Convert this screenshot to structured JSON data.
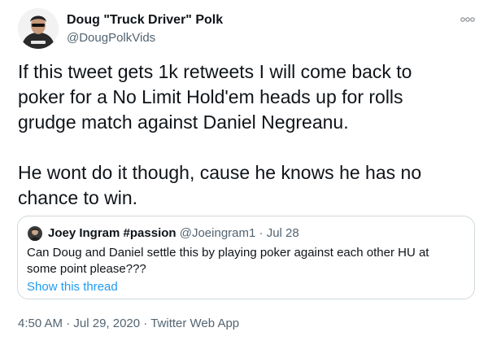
{
  "author": {
    "display_name": "Doug \"Truck Driver\" Polk",
    "handle": "@DougPolkVids"
  },
  "tweet": {
    "lines": [
      "If this tweet gets 1k retweets I will come back to",
      "poker for a No Limit Hold'em heads up for rolls",
      "grudge match against Daniel Negreanu.",
      "",
      "He wont do it though, cause he knows he has no",
      "chance to win."
    ]
  },
  "quote": {
    "display_name": "Joey Ingram #passion",
    "handle": "@Joeingram1",
    "separator": "·",
    "date": "Jul 28",
    "lines": [
      "Can Doug and Daniel settle this by playing poker against each other HU at",
      "some point please???"
    ],
    "show_thread_label": "Show this thread"
  },
  "footer": {
    "time": "4:50 AM",
    "date": "Jul 29, 2020",
    "source": "Twitter Web App",
    "separator": "·"
  },
  "colors": {
    "text": "#0f1419",
    "secondary": "#536471",
    "link": "#1d9bf0",
    "border": "#cfd9de"
  },
  "icons": {
    "more": "more-options-icon"
  }
}
